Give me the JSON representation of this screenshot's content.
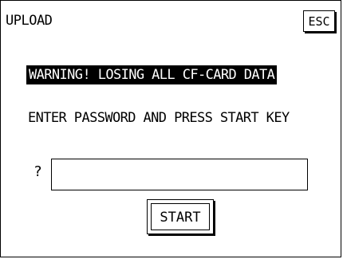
{
  "header": {
    "title": "UPLOAD",
    "esc_label": "ESC"
  },
  "main": {
    "warning": "WARNING! LOSING ALL CF-CARD DATA",
    "instruction": "ENTER PASSWORD AND PRESS START KEY",
    "prompt_mark": "?",
    "password_value": "",
    "start_label": "START"
  },
  "colors": {
    "background": "#ffffff",
    "foreground": "#000000",
    "warning_background": "#000000",
    "warning_text": "#ffffff"
  }
}
